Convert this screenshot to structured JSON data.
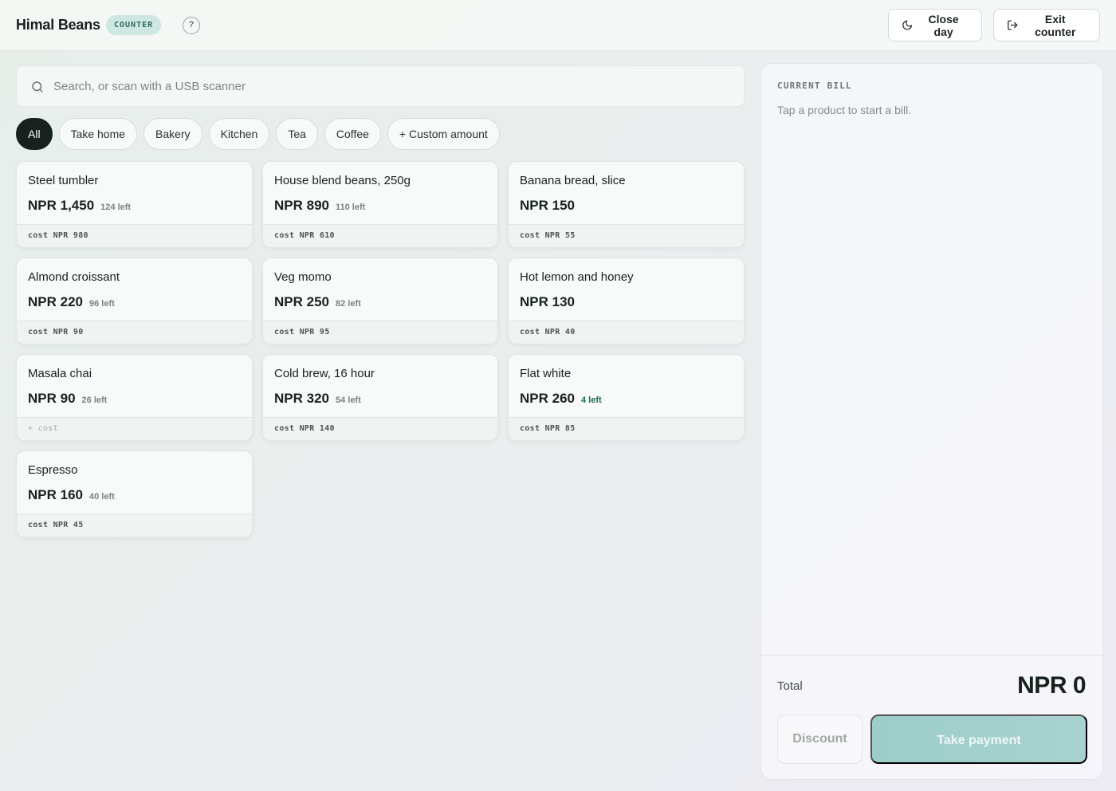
{
  "header": {
    "brand": "Himal Beans",
    "badge": "COUNTER",
    "help": "?",
    "close_day": "Close day",
    "exit_counter": "Exit counter"
  },
  "search": {
    "placeholder": "Search, or scan with a USB scanner",
    "value": ""
  },
  "filters": [
    {
      "label": "All",
      "active": true
    },
    {
      "label": "Take home",
      "active": false
    },
    {
      "label": "Bakery",
      "active": false
    },
    {
      "label": "Kitchen",
      "active": false
    },
    {
      "label": "Tea",
      "active": false
    },
    {
      "label": "Coffee",
      "active": false
    },
    {
      "label": "+ Custom amount",
      "active": false
    }
  ],
  "products": [
    {
      "name": "Steel tumbler",
      "price": "NPR 1,450",
      "stock": "124 left",
      "cost": "cost NPR 980"
    },
    {
      "name": "House blend beans, 250g",
      "price": "NPR 890",
      "stock": "110 left",
      "cost": "cost NPR 610"
    },
    {
      "name": "Banana bread, slice",
      "price": "NPR 150",
      "stock": "",
      "cost": "cost NPR 55"
    },
    {
      "name": "Almond croissant",
      "price": "NPR 220",
      "stock": "96 left",
      "cost": "cost NPR 90"
    },
    {
      "name": "Veg momo",
      "price": "NPR 250",
      "stock": "82 left",
      "cost": "cost NPR 95"
    },
    {
      "name": "Hot lemon and honey",
      "price": "NPR 130",
      "stock": "",
      "cost": "cost NPR 40"
    },
    {
      "name": "Masala chai",
      "price": "NPR 90",
      "stock": "26 left",
      "cost": "+ cost"
    },
    {
      "name": "Cold brew, 16 hour",
      "price": "NPR 320",
      "stock": "54 left",
      "cost": "cost NPR 140"
    },
    {
      "name": "Flat white",
      "price": "NPR 260",
      "stock": "4 left",
      "low_stock": true,
      "cost": "cost NPR 85"
    },
    {
      "name": "Espresso",
      "price": "NPR 160",
      "stock": "40 left",
      "cost": "cost NPR 45"
    }
  ],
  "bill": {
    "title": "CURRENT BILL",
    "empty_message": "Tap a product to start a bill.",
    "total_label": "Total",
    "total_value": "NPR 0",
    "discount_label": "Discount",
    "pay_label": "Take payment"
  },
  "colors": {
    "accent": "#17211d",
    "badge_bg": "#cfe7e1",
    "low_stock": "#1d6a5b",
    "pay_button": "#9dcdc8"
  },
  "icons": {
    "close_day": "moon-icon",
    "exit_counter": "exit-icon",
    "search": "search-icon"
  }
}
